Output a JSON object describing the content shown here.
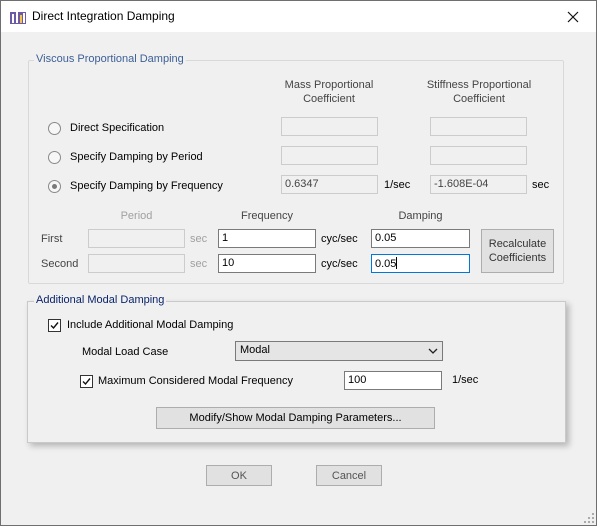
{
  "window": {
    "title": "Direct Integration Damping",
    "app_icon": "app-icon",
    "close_icon": "close-icon"
  },
  "viscous": {
    "group_title": "Viscous Proportional Damping",
    "col_mass": [
      "Mass Proportional",
      "Coefficient"
    ],
    "col_stiffness": [
      "Stiffness Proportional",
      "Coefficient"
    ],
    "options": [
      {
        "label": "Direct Specification",
        "checked": false,
        "mass": "",
        "stiffness": ""
      },
      {
        "label": "Specify Damping by Period",
        "checked": false,
        "mass": "",
        "stiffness": ""
      },
      {
        "label": "Specify Damping by Frequency",
        "checked": true,
        "mass": "0.6347",
        "stiffness": "-1.608E-04"
      }
    ],
    "mass_unit": "1/sec",
    "stiffness_unit": "sec",
    "header_period": "Period",
    "header_frequency": "Frequency",
    "header_damping": "Damping",
    "rows": [
      {
        "label": "First",
        "period": "",
        "period_unit": "sec",
        "frequency": "1",
        "freq_unit": "cyc/sec",
        "damping": "0.05"
      },
      {
        "label": "Second",
        "period": "",
        "period_unit": "sec",
        "frequency": "10",
        "freq_unit": "cyc/sec",
        "damping": "0.05"
      }
    ],
    "recalc_button": [
      "Recalculate",
      "Coefficients"
    ]
  },
  "modal": {
    "group_title": "Additional Modal Damping",
    "include_label": "Include Additional Modal Damping",
    "include_checked": true,
    "load_case_label": "Modal Load Case",
    "load_case_value": "Modal",
    "max_freq_label": "Maximum Considered Modal Frequency",
    "max_freq_checked": true,
    "max_freq_value": "100",
    "max_freq_unit": "1/sec",
    "modify_button": "Modify/Show Modal Damping Parameters..."
  },
  "footer": {
    "ok": "OK",
    "cancel": "Cancel"
  }
}
